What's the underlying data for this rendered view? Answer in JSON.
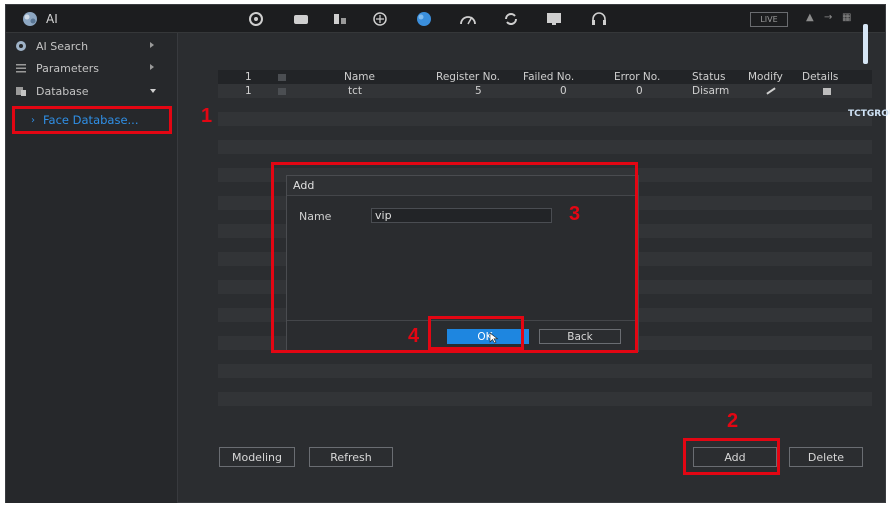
{
  "topbar": {
    "brand": "AI",
    "live_label": "LIVE",
    "icons": [
      "ai-logo-icon",
      "camera-icon",
      "storage-icon",
      "network-icon",
      "config-icon",
      "ai-cloud-icon",
      "performance-icon",
      "maintenance-icon",
      "display-icon",
      "headset-icon"
    ]
  },
  "sidebar": {
    "items": [
      {
        "label": "AI Search",
        "icon": "ai-search-icon"
      },
      {
        "label": "Parameters",
        "icon": "parameters-icon"
      },
      {
        "label": "Database",
        "icon": "database-icon"
      }
    ],
    "sub_item": "Face Database..."
  },
  "table": {
    "headers": [
      "1",
      "",
      "Name",
      "Register No.",
      "Failed No.",
      "Error No.",
      "Status",
      "Modify",
      "Details"
    ],
    "rows": [
      {
        "index": "1",
        "name": "tct",
        "register": "5",
        "failed": "0",
        "error": "0",
        "status": "Disarm"
      }
    ]
  },
  "buttons": {
    "modeling": "Modeling",
    "refresh": "Refresh",
    "add": "Add",
    "delete": "Delete"
  },
  "dialog": {
    "title": "Add",
    "name_label": "Name",
    "name_value": "vip",
    "ok": "OK",
    "back": "Back"
  },
  "annotations": [
    "1",
    "2",
    "3",
    "4"
  ],
  "watermark": "TCTGROUP",
  "colors": {
    "accent": "#1e86e0",
    "highlight": "#e30613",
    "selected_text": "#2f8fe6"
  }
}
